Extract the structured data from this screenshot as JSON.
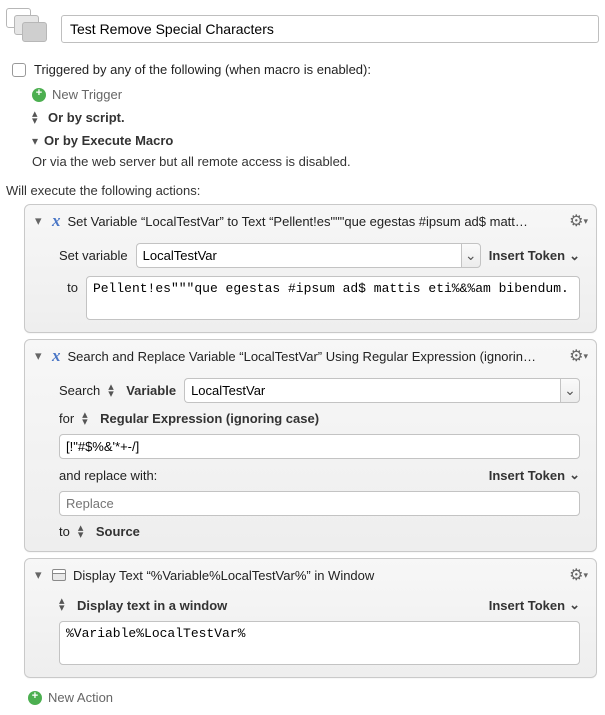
{
  "title": "Test Remove Special Characters",
  "triggers": {
    "checkbox_label": "Triggered by any of the following (when macro is enabled):",
    "new_trigger": "New Trigger",
    "or_script": "Or by script.",
    "or_execute": "Or by Execute Macro",
    "web_disabled": "Or via the web server but all remote access is disabled."
  },
  "exec_label": "Will execute the following actions:",
  "insert_token": "Insert Token",
  "actions": [
    {
      "title": "Set Variable “LocalTestVar” to Text “Pellent!es\"\"\"que egestas #ipsum ad$ matt…",
      "set_variable_label": "Set variable",
      "variable_name": "LocalTestVar",
      "to_label": "to",
      "to_text": "Pellent!es\"\"\"que egestas #ipsum ad$ mattis eti%&%am bibendum."
    },
    {
      "title": "Search and Replace Variable “LocalTestVar” Using Regular Expression (ignorin…",
      "search_label": "Search",
      "variable_selector": "Variable",
      "variable_name": "LocalTestVar",
      "for_label": "for",
      "regex_mode": "Regular Expression (ignoring case)",
      "regex_value": "[!\"#$%&'*+-/]",
      "replace_label": "and replace with:",
      "replace_value": "",
      "replace_placeholder": "Replace",
      "to_label": "to",
      "to_dest": "Source"
    },
    {
      "title": "Display Text “%Variable%LocalTestVar%” in Window",
      "mode": "Display text in a window",
      "text": "%Variable%LocalTestVar%"
    }
  ],
  "new_action": "New Action"
}
